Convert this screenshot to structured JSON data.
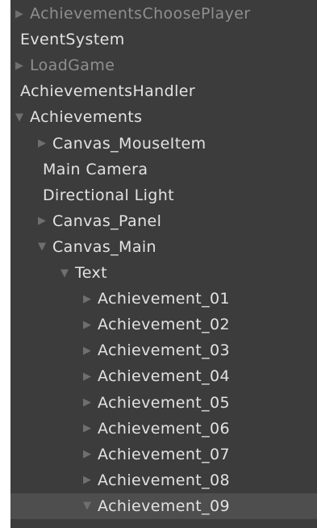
{
  "hierarchy": {
    "items": [
      {
        "label": "AchievementsChoosePlayer",
        "arrow": "▶",
        "depth": 0,
        "dim": true
      },
      {
        "label": "EventSystem",
        "arrow": "",
        "depth": 1,
        "dim": false
      },
      {
        "label": "LoadGame",
        "arrow": "▶",
        "depth": 0,
        "dim": true
      },
      {
        "label": "AchievementsHandler",
        "arrow": "",
        "depth": 1,
        "dim": false
      },
      {
        "label": "Achievements",
        "arrow": "▼",
        "depth": 0,
        "dim": false
      },
      {
        "label": "Canvas_MouseItem",
        "arrow": "▶",
        "depth": 1,
        "dim": false
      },
      {
        "label": "Main Camera",
        "arrow": "",
        "depth": 2,
        "dim": false
      },
      {
        "label": "Directional Light",
        "arrow": "",
        "depth": 2,
        "dim": false
      },
      {
        "label": "Canvas_Panel",
        "arrow": "▶",
        "depth": 1,
        "dim": false
      },
      {
        "label": "Canvas_Main",
        "arrow": "▼",
        "depth": 1,
        "dim": false
      },
      {
        "label": "Text",
        "arrow": "▼",
        "depth": 2,
        "dim": false
      },
      {
        "label": "Achievement_01",
        "arrow": "▶",
        "depth": 3,
        "dim": false
      },
      {
        "label": "Achievement_02",
        "arrow": "▶",
        "depth": 3,
        "dim": false
      },
      {
        "label": "Achievement_03",
        "arrow": "▶",
        "depth": 3,
        "dim": false
      },
      {
        "label": "Achievement_04",
        "arrow": "▶",
        "depth": 3,
        "dim": false
      },
      {
        "label": "Achievement_05",
        "arrow": "▶",
        "depth": 3,
        "dim": false
      },
      {
        "label": "Achievement_06",
        "arrow": "▶",
        "depth": 3,
        "dim": false
      },
      {
        "label": "Achievement_07",
        "arrow": "▶",
        "depth": 3,
        "dim": false
      },
      {
        "label": "Achievement_08",
        "arrow": "▶",
        "depth": 3,
        "dim": false
      },
      {
        "label": "Achievement_09",
        "arrow": "▼",
        "depth": 3,
        "dim": false,
        "selected": true
      }
    ]
  }
}
